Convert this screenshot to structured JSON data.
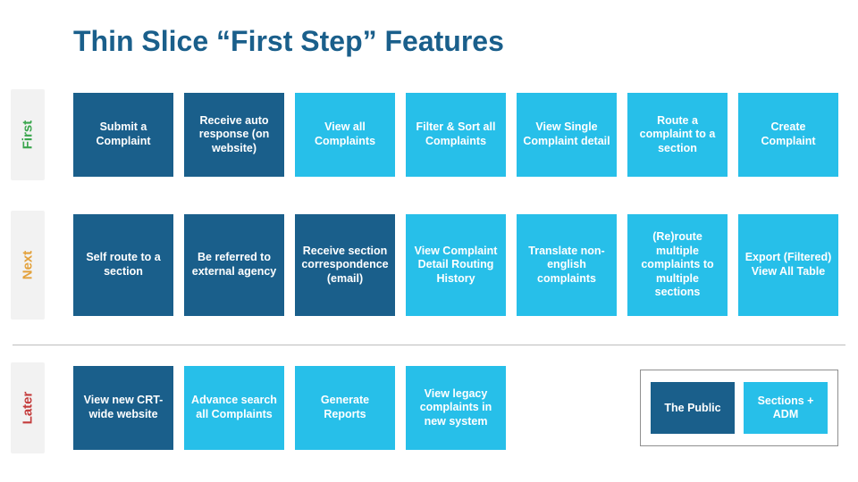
{
  "title": "Thin Slice “First Step” Features",
  "phases": [
    {
      "key": "first",
      "label": "First",
      "color": "#3aa64d"
    },
    {
      "key": "next",
      "label": "Next",
      "color": "#e3a13b"
    },
    {
      "key": "later",
      "label": "Later",
      "color": "#c43c3c"
    }
  ],
  "rows": {
    "first": [
      {
        "text": "Submit a Complaint",
        "style": "dark"
      },
      {
        "text": "Receive auto response (on website)",
        "style": "dark"
      },
      {
        "text": "View all Complaints",
        "style": "light"
      },
      {
        "text": "Filter & Sort all Complaints",
        "style": "light"
      },
      {
        "text": "View Single Complaint detail",
        "style": "light"
      },
      {
        "text": "Route a complaint to a section",
        "style": "light"
      },
      {
        "text": "Create Complaint",
        "style": "light"
      }
    ],
    "next": [
      {
        "text": "Self route to a section",
        "style": "dark"
      },
      {
        "text": "Be referred to external agency",
        "style": "dark"
      },
      {
        "text": "Receive section correspondence  (email)",
        "style": "dark"
      },
      {
        "text": "View Complaint Detail Routing History",
        "style": "light"
      },
      {
        "text": "Translate non-english complaints",
        "style": "light"
      },
      {
        "text": "(Re)route multiple complaints to multiple sections",
        "style": "light"
      },
      {
        "text": "Export (Filtered) View All Table",
        "style": "light"
      }
    ],
    "later": [
      {
        "text": "View new CRT-wide website",
        "style": "dark"
      },
      {
        "text": "Advance search all Complaints",
        "style": "light"
      },
      {
        "text": "Generate Reports",
        "style": "light"
      },
      {
        "text": "View legacy complaints in new system",
        "style": "light"
      }
    ]
  },
  "legend": {
    "dark": "The Public",
    "light": "Sections + ADM"
  },
  "colors": {
    "dark": "#1a5f8b",
    "light": "#27bfe9"
  }
}
